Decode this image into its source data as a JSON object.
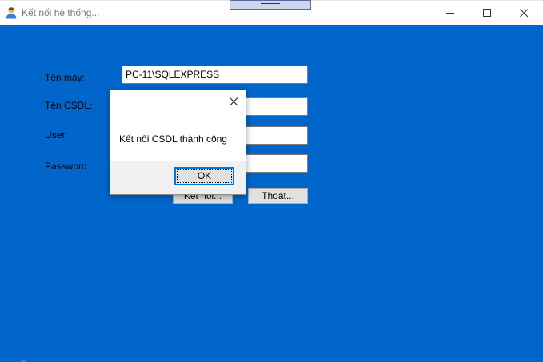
{
  "window": {
    "title": "Kết nối hệ thống...",
    "icon": "user-app-icon",
    "controls": [
      "minimize-icon",
      "maximize-icon",
      "close-icon"
    ]
  },
  "form": {
    "background_color": "#0066cc",
    "fields": [
      {
        "label": "Tên máy:",
        "value": "PC-11\\SQLEXPRESS"
      },
      {
        "label": "Tên CSDL:",
        "value": ""
      },
      {
        "label": "User:",
        "value": ""
      },
      {
        "label": "Password:",
        "value": ""
      }
    ],
    "buttons": {
      "connect": "Kết nối...",
      "exit": "Thoát..."
    }
  },
  "dialog": {
    "message": "Kết nối CSDL thành công",
    "ok_label": "OK",
    "accent_color": "#0078d7"
  }
}
